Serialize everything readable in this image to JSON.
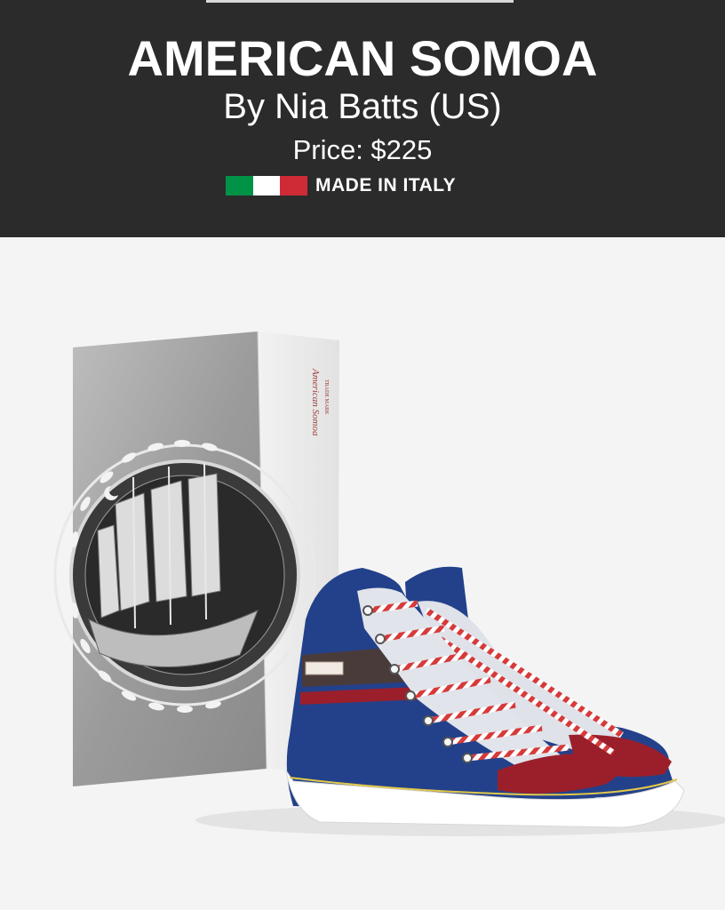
{
  "product": {
    "title": "AMERICAN SOMOA",
    "designer": "By Nia Batts (US)",
    "price": "Price: $225",
    "origin": "MADE IN ITALY",
    "box_brand": "American Somoa",
    "box_sub": "TRADE MARK"
  },
  "colors": {
    "header_bg": "#2b2b2b",
    "flag_green": "#009246",
    "flag_white": "#ffffff",
    "flag_red": "#ce2b37",
    "shoe_blue": "#23418a",
    "shoe_red": "#9b1f2b",
    "lace_red": "#d63a3a"
  },
  "icons": [
    "italy-flag-icon"
  ]
}
